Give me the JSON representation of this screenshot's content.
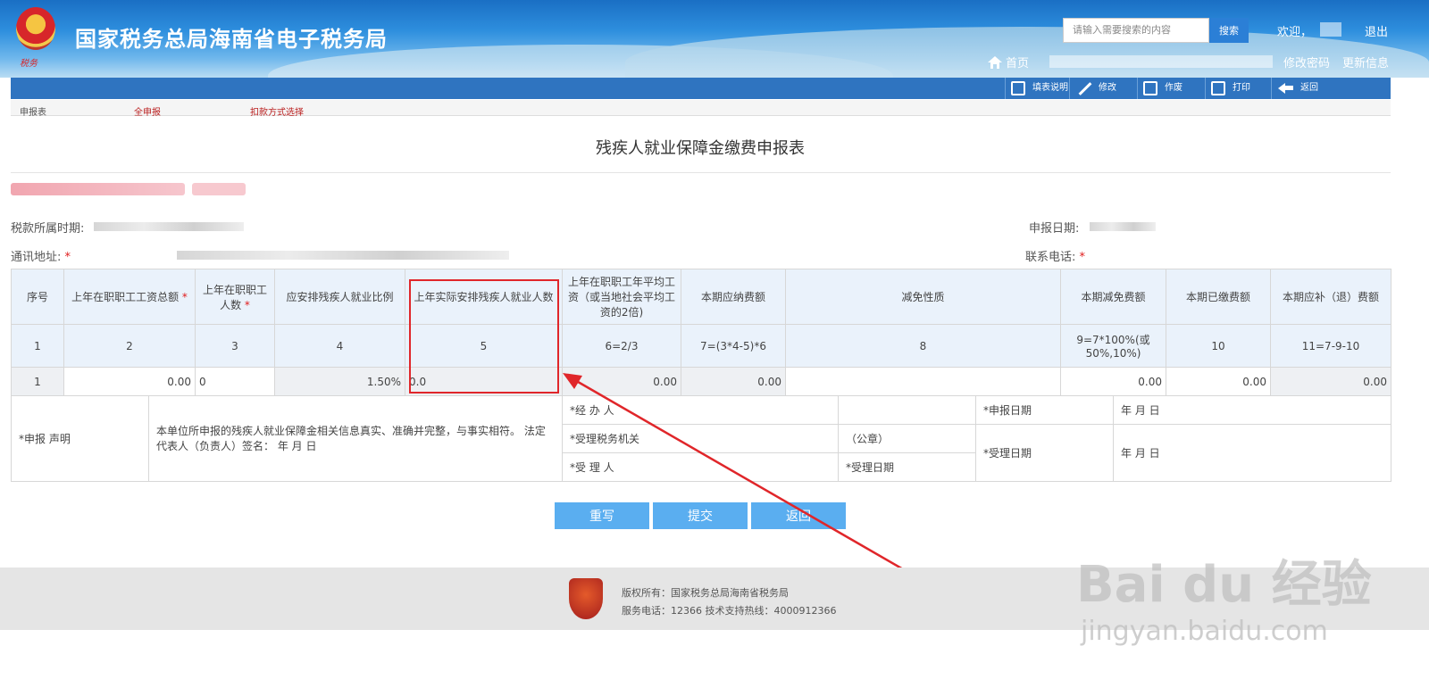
{
  "header": {
    "site_title": "国家税务总局海南省电子税务局",
    "search_placeholder": "请输入需要搜索的内容",
    "search_button": "搜索",
    "welcome": "欢迎，",
    "logout": "退出",
    "home": "首页",
    "change_password": "修改密码",
    "update_info": "更新信息"
  },
  "toolbar": {
    "fill_instructions": "填表说明",
    "modify": "修改",
    "void": "作废",
    "print": "打印",
    "back": "返回"
  },
  "tabs": [
    "申报表",
    "全申报",
    "扣款方式选择"
  ],
  "form": {
    "title": "残疾人就业保障金缴费申报表",
    "tax_period_label": "税款所属时期:",
    "report_date_label": "申报日期:",
    "address_label": "通讯地址:",
    "phone_label": "联系电话:",
    "required_mark": "*"
  },
  "table": {
    "headers": [
      "序号",
      "上年在职职工工资总额",
      "上年在职职工人数",
      "应安排残疾人就业比例",
      "上年实际安排残疾人就业人数",
      "上年在职职工年平均工资（或当地社会平均工资的2倍)",
      "本期应纳费额",
      "减免性质",
      "本期减免费额",
      "本期已缴费额",
      "本期应补（退）费额"
    ],
    "index_row": [
      "1",
      "2",
      "3",
      "4",
      "5",
      "6=2/3",
      "7=(3*4-5)*6",
      "8",
      "9=7*100%(或50%,10%)",
      "10",
      "11=7-9-10"
    ],
    "data_row": [
      "1",
      "0.00",
      "0",
      "1.50%",
      "0.0",
      "0.00",
      "0.00",
      "",
      "0.00",
      "0.00",
      "0.00"
    ]
  },
  "declaration": {
    "label": "*申报 声明",
    "text": "本单位所申报的残疾人就业保障金相关信息真实、准确并完整，与事实相符。 法定代表人（负责人）签名： 年 月 日",
    "handler": "*经 办 人",
    "tax_authority": "*受理税务机关",
    "seal": "（公章）",
    "receiver": "*受 理 人",
    "receive_date_label": "*受理日期",
    "report_date": "*申报日期",
    "ymd1": "年 月 日",
    "accept_date": "*受理日期",
    "ymd2": "年 月 日"
  },
  "buttons": {
    "reset": "重写",
    "submit": "提交",
    "back": "返回"
  },
  "footer": {
    "copyright": "版权所有：国家税务总局海南省税务局",
    "service": "服务电话：12366 技术支持热线：4000912366"
  },
  "watermark": {
    "brand": "Bai du 经验",
    "url": "jingyan.baidu.com"
  }
}
